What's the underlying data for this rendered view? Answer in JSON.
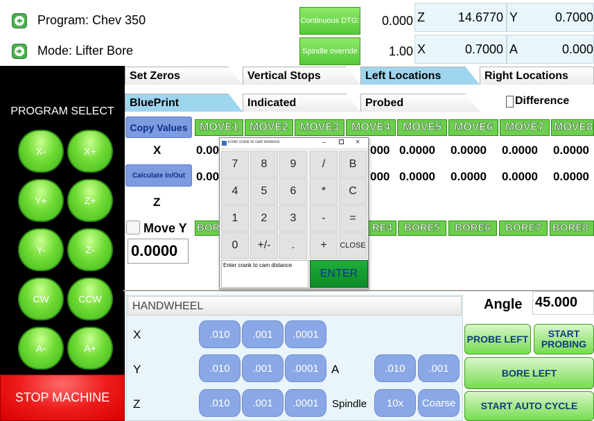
{
  "header": {
    "program": "Program: Chev 350",
    "mode": "Mode: Lifter Bore",
    "continuous_btn": "Continuous DTG:",
    "spindle_btn": "Spindle override",
    "dtg_value": "0.000",
    "override_value": "1.00",
    "dro": [
      {
        "axis": "Z",
        "value": "14.6770"
      },
      {
        "axis": "Y",
        "value": "0.7000"
      },
      {
        "axis": "X",
        "value": "0.7000"
      },
      {
        "axis": "A",
        "value": "0.000"
      }
    ]
  },
  "sidebar": {
    "title": "PROGRAM SELECT",
    "buttons": [
      "X-",
      "X+",
      "Y+",
      "Z+",
      "Y-",
      "Z-",
      "CW",
      "CCW",
      "A-",
      "A+"
    ],
    "stop": "STOP MACHINE"
  },
  "tabs_top": [
    "Set Zeros",
    "Vertical Stops",
    "Left Locations",
    "Right Locations"
  ],
  "tabs_sub": [
    "BluePrint",
    "Indicated",
    "Probed"
  ],
  "difference_label": "Difference",
  "grid": {
    "copy_values": "Copy Values",
    "calculate": "Calculate In/Out",
    "moves": [
      "MOVE1",
      "MOVE2",
      "MOVE3",
      "MOVE4",
      "MOVE5",
      "MOVE6",
      "MOVE7",
      "MOVE8"
    ],
    "row_x_label": "X",
    "row_z_label": "Z",
    "x_values": [
      "0.00",
      "000",
      "0.0000",
      "0.0000",
      "0.0000",
      "0.0000"
    ],
    "z_values": [
      "0.00",
      "000",
      "0.0000",
      "0.0000",
      "0.0000",
      "0.0000"
    ],
    "move_y_label": "Move Y",
    "move_y_value": "0.0000",
    "bores": [
      "BOR",
      "RE4",
      "BORE5",
      "BORE6",
      "BORE7",
      "BORE8"
    ]
  },
  "dialog": {
    "title": "Enter crank to cam distance",
    "keys": [
      "7",
      "8",
      "9",
      "/",
      "B",
      "4",
      "5",
      "6",
      "*",
      "C",
      "1",
      "2",
      "3",
      "-",
      "=",
      "0",
      "+/-",
      ".",
      "+",
      "CLOSE"
    ],
    "prompt": "Enter crank to cam distance",
    "enter": "ENTER"
  },
  "handwheel": {
    "title": "HANDWHEEL",
    "x_label": "X",
    "y_label": "Y",
    "z_label": "Z",
    "a_label": "A",
    "spindle_label": "Spindle",
    "steps": [
      ".010",
      ".001",
      ".0001"
    ],
    "a_steps": [
      ".010",
      ".001"
    ],
    "spindle_steps": [
      "10x",
      "Coarse"
    ]
  },
  "right_panel": {
    "angle_label": "Angle",
    "angle_value": "45.000",
    "probe_left": "PROBE LEFT",
    "start_probing": "START PROBING",
    "bore_left": "BORE LEFT",
    "start_auto_cycle": "START AUTO CYCLE"
  }
}
